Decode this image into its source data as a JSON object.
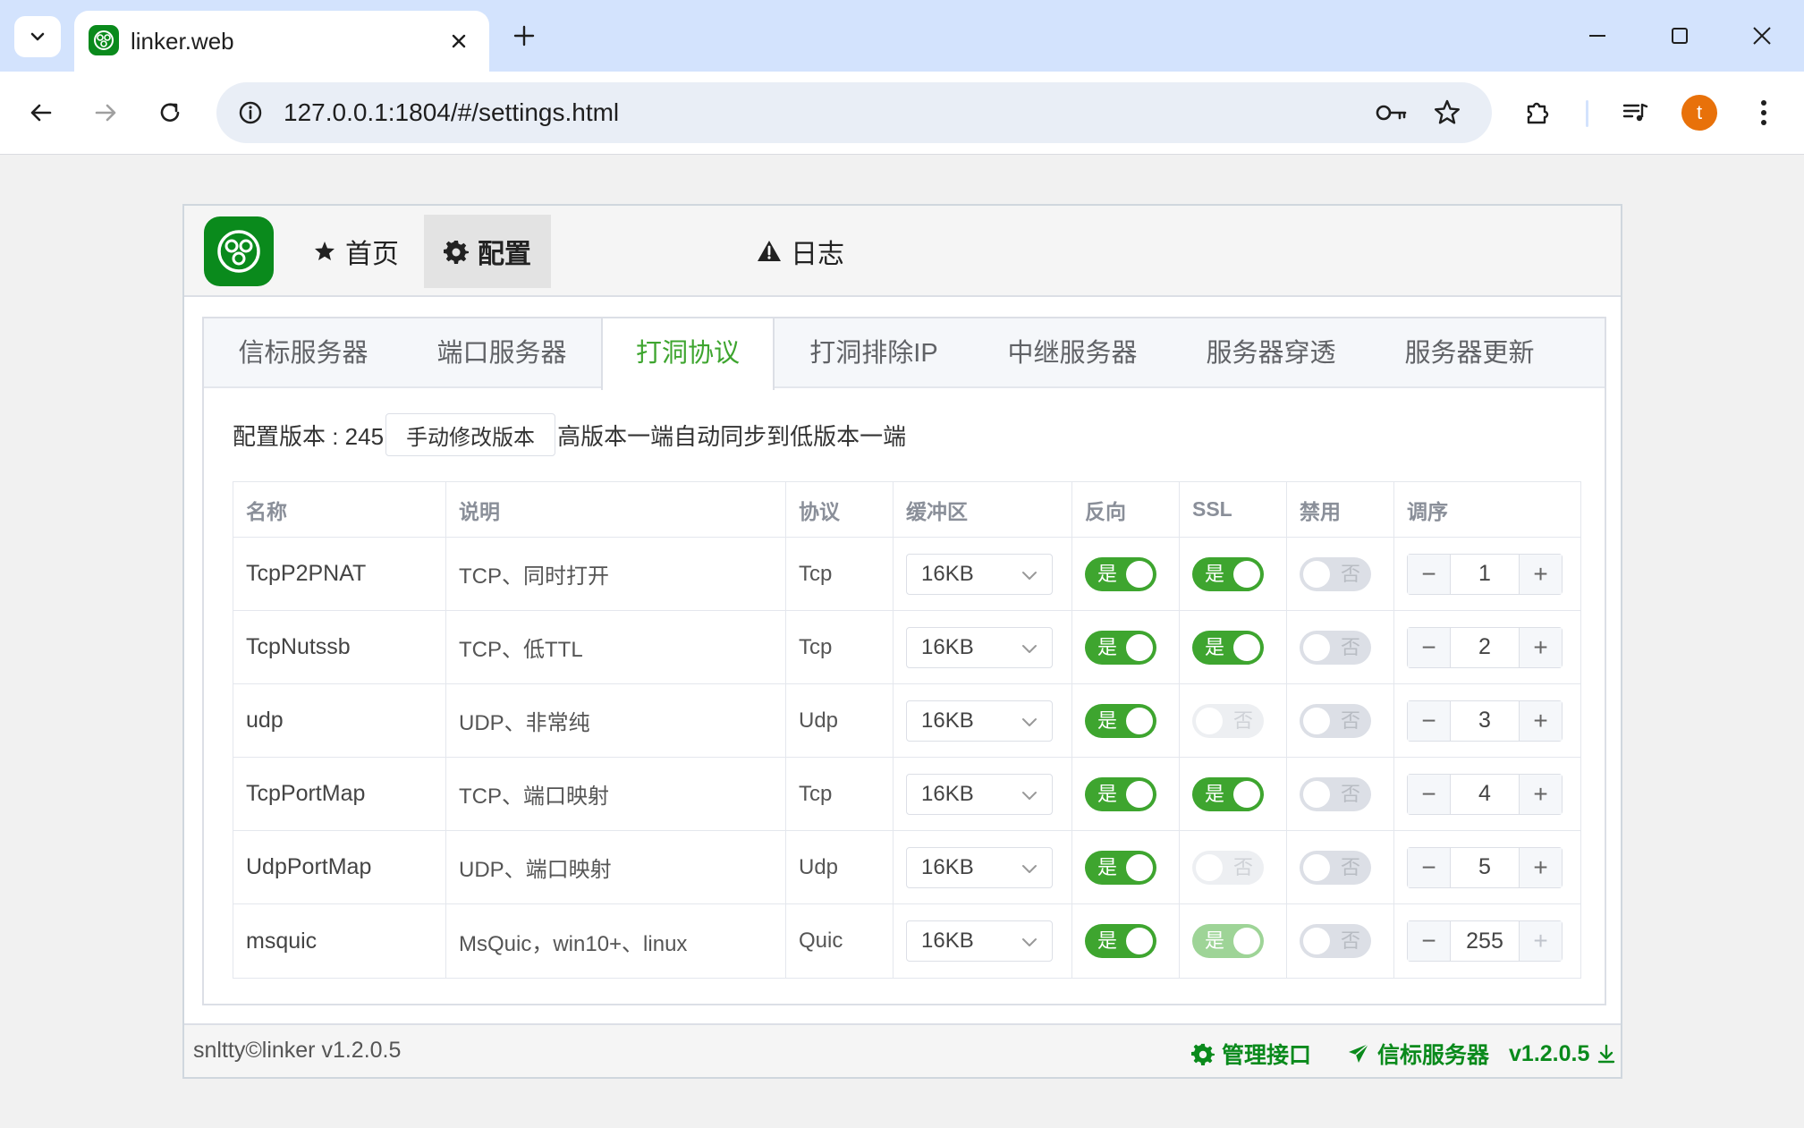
{
  "browser": {
    "tab_title": "linker.web",
    "url": "127.0.0.1:1804/#/settings.html",
    "profile_initial": "t"
  },
  "nav": {
    "items": [
      {
        "label": "首页",
        "icon": "star-icon"
      },
      {
        "label": "配置",
        "icon": "gear-icon"
      },
      {
        "label": "日志",
        "icon": "warning-icon"
      }
    ],
    "active": "配置"
  },
  "settings_tabs": [
    "信标服务器",
    "端口服务器",
    "打洞协议",
    "打洞排除IP",
    "中继服务器",
    "服务器穿透",
    "服务器更新"
  ],
  "active_tab": "打洞协议",
  "config": {
    "version_label": "配置版本 : 245",
    "edit_button": "手动修改版本",
    "note": "高版本一端自动同步到低版本一端"
  },
  "table": {
    "headers": [
      "名称",
      "说明",
      "协议",
      "缓冲区",
      "反向",
      "SSL",
      "禁用",
      "调序"
    ],
    "rows": [
      {
        "name": "TcpP2PNAT",
        "desc": "TCP、同时打开",
        "proto": "Tcp",
        "buffer": "16KB",
        "reverse": "是",
        "ssl": "是",
        "disabled": "否",
        "order": "1"
      },
      {
        "name": "TcpNutssb",
        "desc": "TCP、低TTL",
        "proto": "Tcp",
        "buffer": "16KB",
        "reverse": "是",
        "ssl": "是",
        "disabled": "否",
        "order": "2"
      },
      {
        "name": "udp",
        "desc": "UDP、非常纯",
        "proto": "Udp",
        "buffer": "16KB",
        "reverse": "是",
        "ssl": "否",
        "disabled": "否",
        "order": "3"
      },
      {
        "name": "TcpPortMap",
        "desc": "TCP、端口映射",
        "proto": "Tcp",
        "buffer": "16KB",
        "reverse": "是",
        "ssl": "是",
        "disabled": "否",
        "order": "4"
      },
      {
        "name": "UdpPortMap",
        "desc": "UDP、端口映射",
        "proto": "Udp",
        "buffer": "16KB",
        "reverse": "是",
        "ssl": "否",
        "disabled": "否",
        "order": "5"
      },
      {
        "name": "msquic",
        "desc": "MsQuic，win10+、linux",
        "proto": "Quic",
        "buffer": "16KB",
        "reverse": "是",
        "ssl": "是",
        "disabled": "否",
        "order": "255"
      }
    ]
  },
  "footer": {
    "copyright": "snltty©linker v1.2.0.5",
    "api_link": "管理接口",
    "server_link": "信标服务器",
    "server_version": "v1.2.0.5"
  },
  "colors": {
    "accent": "#3ea52f",
    "brand": "#0a8a1c"
  }
}
